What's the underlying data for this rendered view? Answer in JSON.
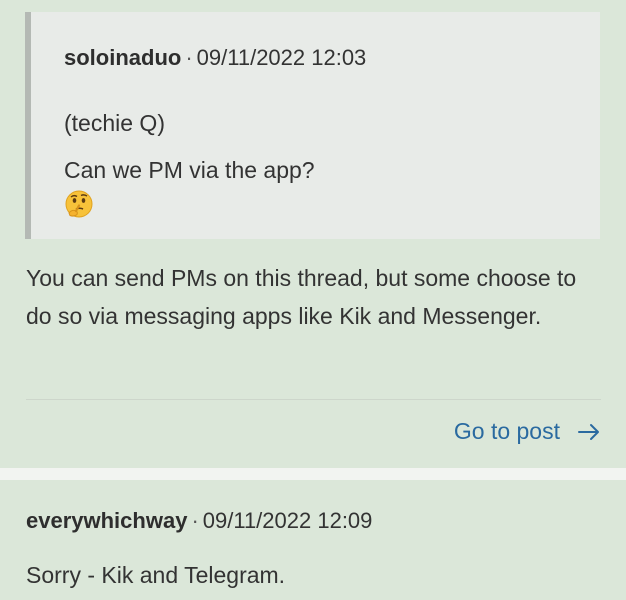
{
  "post1": {
    "quote": {
      "author": "soloinaduo",
      "separator": "·",
      "timestamp": "09/11/2022 12:03",
      "line1": "(techie Q)",
      "line2": "Can we PM via the app?",
      "emoji": "thinking-face-icon"
    },
    "body": "You can send PMs on this thread, but some choose to do so via messaging apps like Kik and Messenger.",
    "goto_label": "Go to post",
    "goto_icon": "arrow-right-icon"
  },
  "post2": {
    "author": "everywhichway",
    "separator": "·",
    "timestamp": "09/11/2022 12:09",
    "body": "Sorry - Kik and Telegram."
  },
  "colors": {
    "card_bg": "#dbe7d9",
    "quote_bg": "#e8ebe8",
    "quote_border": "#b4b9b4",
    "link": "#2a6aa0"
  }
}
